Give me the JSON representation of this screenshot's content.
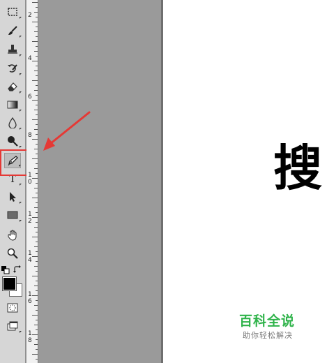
{
  "toolbar": {
    "tools": [
      "marquee-tool",
      "brush-tool",
      "clone-stamp-tool",
      "history-brush-tool",
      "eraser-tool",
      "gradient-tool",
      "blur-tool",
      "dodge-tool",
      "pen-tool",
      "type-tool",
      "path-selection-tool",
      "rectangle-tool",
      "hand-tool",
      "zoom-tool"
    ],
    "selected_tool": "pen-tool",
    "type_tool_glyph": "T",
    "foreground_color": "#000000",
    "background_color": "#ffffff"
  },
  "ruler": {
    "labels": [
      "2",
      "4",
      "6",
      "8",
      "1 0",
      "1 2",
      "1 4",
      "1 6",
      "1 8"
    ]
  },
  "canvas": {
    "character": "搜"
  },
  "watermark": {
    "title": "百科全说",
    "subtitle": "助你轻松解决",
    "title_color": "#2fb34a"
  },
  "annotation": {
    "highlight_color": "#e53935"
  }
}
